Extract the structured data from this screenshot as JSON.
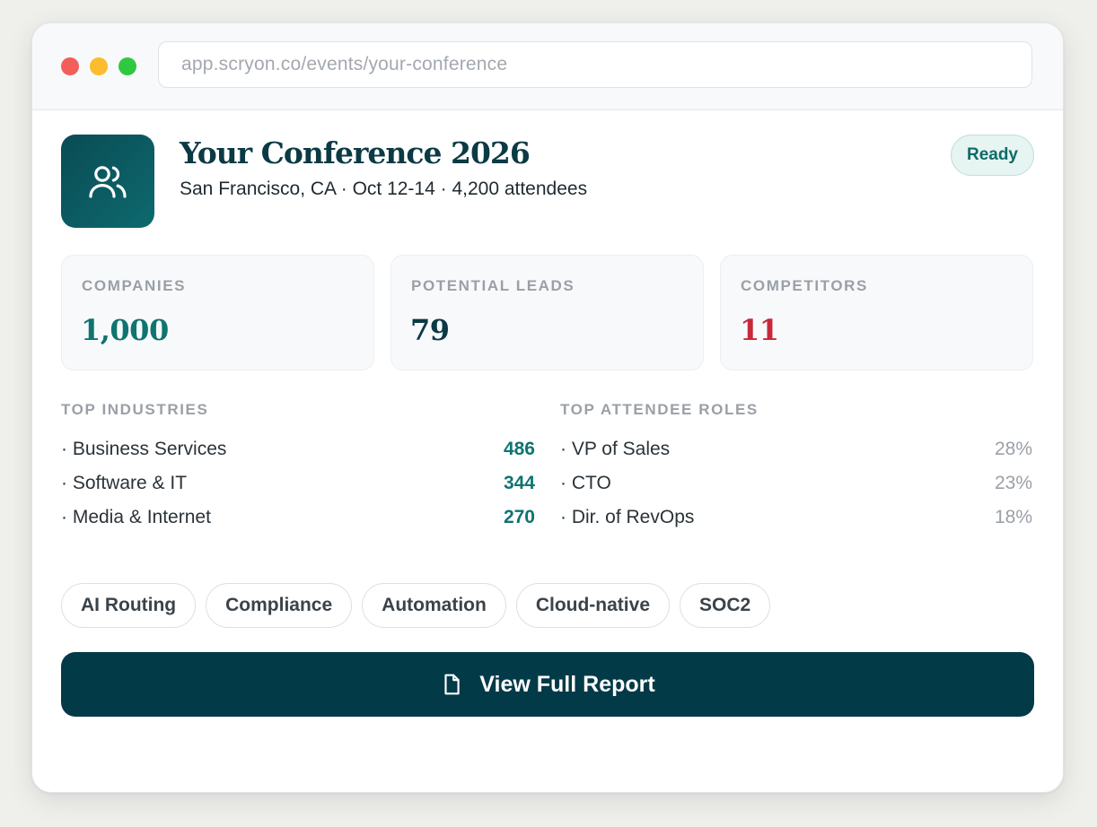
{
  "browser": {
    "url": "app.scryon.co/events/your-conference"
  },
  "event": {
    "icon": "users-icon",
    "title": "Your Conference 2026",
    "subtitle": "San Francisco, CA · Oct 12-14 · 4,200 attendees",
    "status": "Ready"
  },
  "stats": [
    {
      "label": "COMPANIES",
      "value": "1,000",
      "color": "#0f7470"
    },
    {
      "label": "POTENTIAL LEADS",
      "value": "79",
      "color": "#0b3a44"
    },
    {
      "label": "COMPETITORS",
      "value": "11",
      "color": "#c8283a"
    }
  ],
  "industries": {
    "title": "TOP INDUSTRIES",
    "items": [
      {
        "label": "· Business Services",
        "value": "486"
      },
      {
        "label": "· Software & IT",
        "value": "344"
      },
      {
        "label": "· Media & Internet",
        "value": "270"
      }
    ]
  },
  "roles": {
    "title": "TOP ATTENDEE ROLES",
    "items": [
      {
        "label": "· VP of Sales",
        "value": "28%"
      },
      {
        "label": "· CTO",
        "value": "23%"
      },
      {
        "label": "· Dir. of RevOps",
        "value": "18%"
      }
    ]
  },
  "tags": [
    "AI Routing",
    "Compliance",
    "Automation",
    "Cloud-native",
    "SOC2"
  ],
  "cta": {
    "icon": "document-icon",
    "label": "View Full Report"
  },
  "colors": {
    "primary": "#023a48",
    "accent": "#0f7470",
    "danger": "#c8283a"
  }
}
